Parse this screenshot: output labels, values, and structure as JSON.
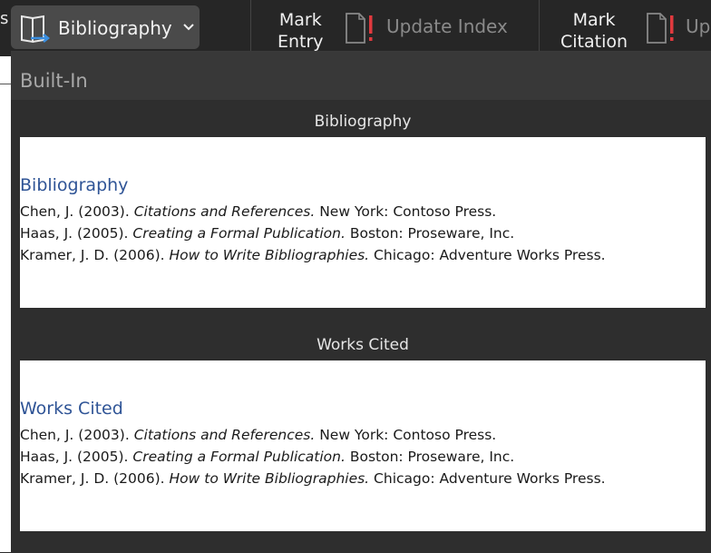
{
  "toolbar": {
    "edge_char": "s",
    "bibliography_button": {
      "label": "Bibliography",
      "icon": "book-icon",
      "chevron": "chevron-down-icon"
    },
    "mark_entry": {
      "line1": "Mark",
      "line2": "Entry"
    },
    "update_index": {
      "label": "Update Index",
      "icon": "doc-alert-icon"
    },
    "mark_citation": {
      "line1": "Mark",
      "line2": "Citation"
    },
    "update_table_partial": {
      "label": "Up",
      "icon": "doc-alert-icon"
    }
  },
  "panel": {
    "header": "Built-In",
    "sections": [
      {
        "title": "Bibliography",
        "heading": "Bibliography",
        "entries": [
          {
            "pre": "Chen, J. (2003). ",
            "italic": "Citations and References.",
            "post": " New York: Contoso Press."
          },
          {
            "pre": "Haas, J. (2005). ",
            "italic": "Creating a Formal Publication.",
            "post": " Boston: Proseware, Inc."
          },
          {
            "pre": "Kramer, J. D. (2006). ",
            "italic": "How to Write Bibliographies.",
            "post": " Chicago: Adventure Works Press."
          }
        ]
      },
      {
        "title": "Works Cited",
        "heading": "Works Cited",
        "entries": [
          {
            "pre": "Chen, J. (2003). ",
            "italic": "Citations and References.",
            "post": " New York: Contoso Press."
          },
          {
            "pre": "Haas, J. (2005). ",
            "italic": "Creating a Formal Publication.",
            "post": " Boston: Proseware, Inc."
          },
          {
            "pre": "Kramer, J. D. (2006). ",
            "italic": "How to Write Bibliographies.",
            "post": " Chicago: Adventure Works Press."
          }
        ]
      }
    ]
  },
  "colors": {
    "accent_heading": "#2f5496",
    "alert_red": "#e0393e",
    "book_blue": "#3b8fe0"
  }
}
